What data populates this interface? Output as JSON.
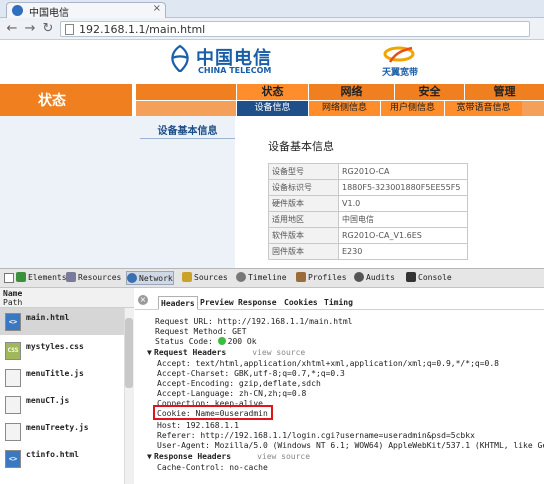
{
  "browser": {
    "tab_title": "中国电信",
    "tab_close": "×",
    "url": "192.168.1.1/main.html"
  },
  "brand": {
    "cn": "中国电信",
    "en": "CHINA TELECOM",
    "tianyi": "天翼宽带",
    "colors": {
      "orange": "#f07f1f",
      "blue": "#1f4f88"
    }
  },
  "nav": {
    "current": "状态",
    "main_tabs": [
      "状态",
      "网络",
      "安全",
      "管理"
    ],
    "sub_tabs": [
      "设备信息",
      "网络侧信息",
      "用户侧信息",
      "宽带语音信息"
    ]
  },
  "sidebar": {
    "link": "设备基本信息"
  },
  "content": {
    "title": "设备基本信息",
    "rows": [
      {
        "key": "设备型号",
        "value": "RG201O-CA"
      },
      {
        "key": "设备标识号",
        "value": "1880F5-323001880F5EE55F5"
      },
      {
        "key": "硬件版本",
        "value": "V1.0"
      },
      {
        "key": "适用地区",
        "value": "中国电信"
      },
      {
        "key": "软件版本",
        "value": "RG201O-CA_V1.6ES"
      },
      {
        "key": "固件版本",
        "value": "E230"
      }
    ]
  },
  "devtools": {
    "toolbar": [
      "Elements",
      "Resources",
      "Network",
      "Sources",
      "Timeline",
      "Profiles",
      "Audits",
      "Console"
    ],
    "left_header": {
      "name": "Name",
      "path": "Path"
    },
    "files": [
      {
        "name": "main.html",
        "icon": "<>"
      },
      {
        "name": "mystyles.css",
        "icon": "CSS"
      },
      {
        "name": "menuTitle.js",
        "icon": ""
      },
      {
        "name": "menuCT.js",
        "icon": ""
      },
      {
        "name": "menuTreety.js",
        "icon": ""
      },
      {
        "name": "ctinfo.html",
        "icon": "<>"
      }
    ],
    "detail_tabs": [
      "Headers",
      "Preview",
      "Response",
      "Cookies",
      "Timing"
    ],
    "close": "×",
    "general": {
      "request_url": "Request URL: http://192.168.1.1/main.html",
      "request_method": "Request Method: GET",
      "status_code_label": "Status Code:",
      "status_code": "200 Ok"
    },
    "request_headers_title": "Request Headers",
    "view_source": "view source",
    "request_headers": {
      "accept": "Accept: text/html,application/xhtml+xml,application/xml;q=0.9,*/*;q=0.8",
      "accept_charset": "Accept-Charset: GBK,utf-8;q=0.7,*;q=0.3",
      "accept_encoding": "Accept-Encoding: gzip,deflate,sdch",
      "accept_language": "Accept-Language: zh-CN,zh;q=0.8",
      "connection": "Connection: keep-alive",
      "cookie": "Cookie: Name=0useradmin",
      "host": "Host: 192.168.1.1",
      "referer": "Referer: http://192.168.1.1/login.cgi?username=useradmin&psd=5cbkx",
      "user_agent": "User-Agent: Mozilla/5.0 (Windows NT 6.1; WOW64) AppleWebKit/537.1 (KHTML, like Ge"
    },
    "response_headers_title": "Response Headers",
    "response_headers": {
      "cache_control": "Cache-Control: no-cache"
    }
  }
}
